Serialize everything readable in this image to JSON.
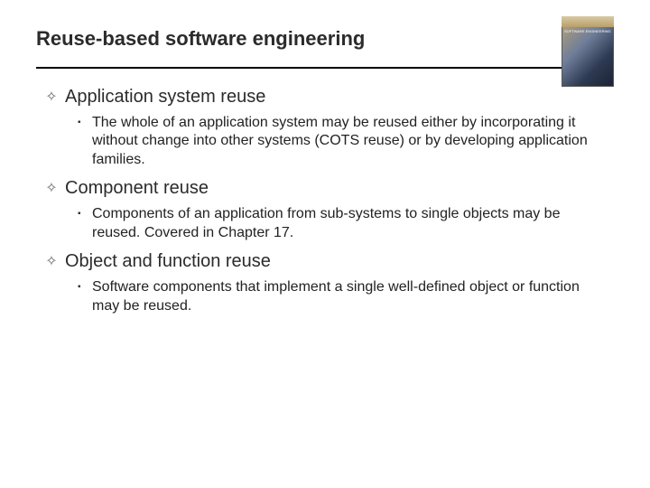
{
  "title": "Reuse-based software engineering",
  "thumbnail_label": "SOFTWARE ENGINEERING",
  "sections": [
    {
      "heading": "Application system reuse",
      "bullet": "The whole of an application system may be reused either by incorporating it without change into other systems (COTS reuse) or by developing application families."
    },
    {
      "heading": "Component reuse",
      "bullet": "Components of an application from sub-systems to single objects may be reused. Covered in Chapter 17."
    },
    {
      "heading": "Object and function reuse",
      "bullet": "Software components that implement a single well-defined object or function may be reused."
    }
  ]
}
